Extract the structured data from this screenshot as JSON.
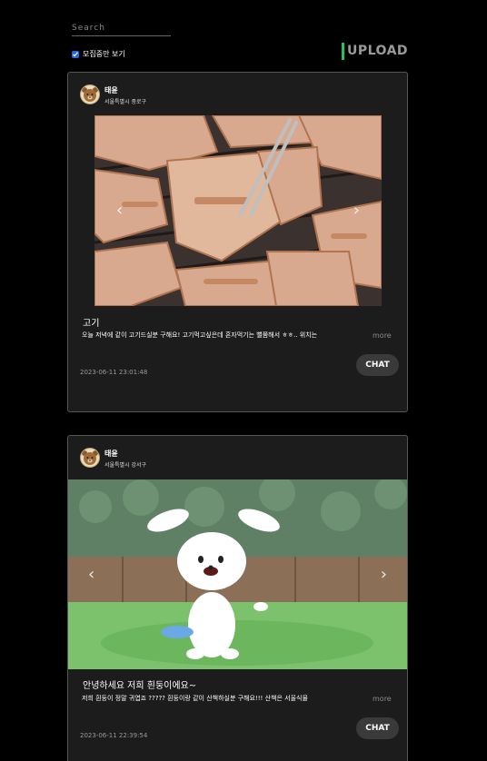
{
  "search": {
    "placeholder": "Search"
  },
  "filter": {
    "label": "모집중만 보기",
    "checked": true
  },
  "upload": {
    "label": "UPLOAD",
    "accent": "#22c55e"
  },
  "posts": [
    {
      "author": "태윤",
      "location": "서울특별시 중로구",
      "title": "고기",
      "description": "오늘 저녁에 같이 고기드실분 구해요! 고기먹고싶은데 혼자먹기는 뻘쭘해서 ㅎㅎ.. 위치는",
      "more": "more",
      "date": "2023-06-11 23:01:48",
      "chat": "CHAT",
      "image": "grilled-pork-belly"
    },
    {
      "author": "태윤",
      "location": "서울특별시 강서구",
      "title": "안녕하세요 저희 흰둥이에요~",
      "description": "저희 흰둥이 정말 귀엽죠 ????? 흰둥이랑 같이 산책하실분 구해요!!! 산책은 서울식물",
      "more": "more",
      "date": "2023-06-11 22:39:54",
      "chat": "CHAT",
      "image": "white-cartoon-dog"
    }
  ],
  "icons": {
    "prev": "chevron-left-icon",
    "next": "chevron-right-icon",
    "avatar": "bear-avatar-icon"
  }
}
